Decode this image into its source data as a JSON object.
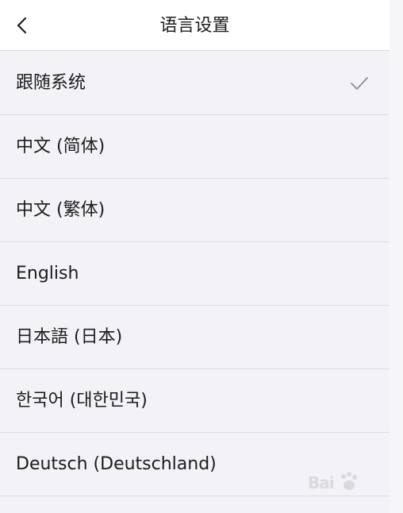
{
  "header": {
    "title": "语言设置",
    "back_icon": "chevron-left-icon"
  },
  "languages": [
    {
      "label": "跟随系统",
      "selected": true
    },
    {
      "label": "中文 (简体)",
      "selected": false
    },
    {
      "label": "中文 (繁体)",
      "selected": false
    },
    {
      "label": "English",
      "selected": false
    },
    {
      "label": "日本語 (日本)",
      "selected": false
    },
    {
      "label": "한국어 (대한민국)",
      "selected": false
    },
    {
      "label": "Deutsch (Deutschland)",
      "selected": false
    }
  ],
  "selected_icon": "checkmark-icon",
  "watermark": {
    "text": "Bai"
  },
  "colors": {
    "background": "#f2f2f7",
    "header_bg": "#ffffff",
    "text": "#1c1c1e",
    "separator": "#dcdce0",
    "checkmark": "#8e8e93"
  }
}
